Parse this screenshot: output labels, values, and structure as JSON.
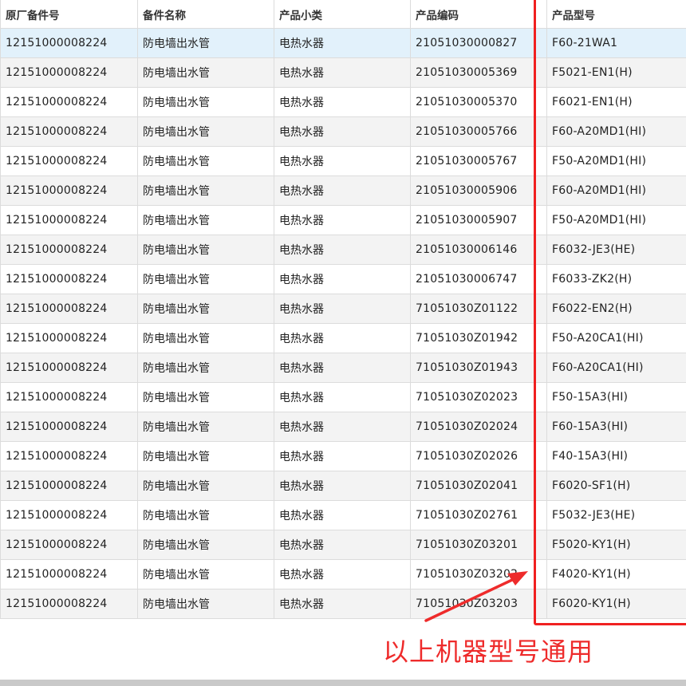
{
  "table": {
    "headers": [
      "原厂备件号",
      "备件名称",
      "产品小类",
      "产品编码",
      "产品型号"
    ],
    "rows": [
      [
        "12151000008224",
        "防电墙出水管",
        "电热水器",
        "21051030000827",
        "F60-21WA1"
      ],
      [
        "12151000008224",
        "防电墙出水管",
        "电热水器",
        "21051030005369",
        "F5021-EN1(H)"
      ],
      [
        "12151000008224",
        "防电墙出水管",
        "电热水器",
        "21051030005370",
        "F6021-EN1(H)"
      ],
      [
        "12151000008224",
        "防电墙出水管",
        "电热水器",
        "21051030005766",
        "F60-A20MD1(HI)"
      ],
      [
        "12151000008224",
        "防电墙出水管",
        "电热水器",
        "21051030005767",
        "F50-A20MD1(HI)"
      ],
      [
        "12151000008224",
        "防电墙出水管",
        "电热水器",
        "21051030005906",
        "F60-A20MD1(HI)"
      ],
      [
        "12151000008224",
        "防电墙出水管",
        "电热水器",
        "21051030005907",
        "F50-A20MD1(HI)"
      ],
      [
        "12151000008224",
        "防电墙出水管",
        "电热水器",
        "21051030006146",
        "F6032-JE3(HE)"
      ],
      [
        "12151000008224",
        "防电墙出水管",
        "电热水器",
        "21051030006747",
        "F6033-ZK2(H)"
      ],
      [
        "12151000008224",
        "防电墙出水管",
        "电热水器",
        "71051030Z01122",
        "F6022-EN2(H)"
      ],
      [
        "12151000008224",
        "防电墙出水管",
        "电热水器",
        "71051030Z01942",
        "F50-A20CA1(HI)"
      ],
      [
        "12151000008224",
        "防电墙出水管",
        "电热水器",
        "71051030Z01943",
        "F60-A20CA1(HI)"
      ],
      [
        "12151000008224",
        "防电墙出水管",
        "电热水器",
        "71051030Z02023",
        "F50-15A3(HI)"
      ],
      [
        "12151000008224",
        "防电墙出水管",
        "电热水器",
        "71051030Z02024",
        "F60-15A3(HI)"
      ],
      [
        "12151000008224",
        "防电墙出水管",
        "电热水器",
        "71051030Z02026",
        "F40-15A3(HI)"
      ],
      [
        "12151000008224",
        "防电墙出水管",
        "电热水器",
        "71051030Z02041",
        "F6020-SF1(H)"
      ],
      [
        "12151000008224",
        "防电墙出水管",
        "电热水器",
        "71051030Z02761",
        "F5032-JE3(HE)"
      ],
      [
        "12151000008224",
        "防电墙出水管",
        "电热水器",
        "71051030Z03201",
        "F5020-KY1(H)"
      ],
      [
        "12151000008224",
        "防电墙出水管",
        "电热水器",
        "71051030Z03202",
        "F4020-KY1(H)"
      ],
      [
        "12151000008224",
        "防电墙出水管",
        "电热水器",
        "71051030Z03203",
        "F6020-KY1(H)"
      ]
    ],
    "selected_row": 0
  },
  "annotation": {
    "text": "以上机器型号通用",
    "color": "#ee2b2b"
  },
  "colors": {
    "selected_row_bg": "#e2f1fb",
    "alt_row_bg": "#f3f3f3",
    "border": "#dcdcdc",
    "highlight": "#f02020"
  }
}
